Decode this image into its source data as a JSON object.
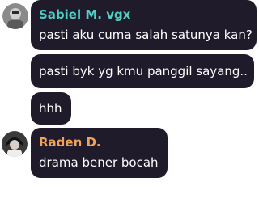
{
  "messages": [
    {
      "sender": "Sabiel M. vgx",
      "sender_color": "#4fd1c5",
      "avatar": "avatar-sabiel",
      "lines": [
        "pasti aku cuma salah satunya kan?",
        "pasti byk yg kmu panggil sayang..",
        "hhh"
      ]
    },
    {
      "sender": "Raden D.",
      "sender_color": "#f0a25b",
      "avatar": "avatar-raden",
      "lines": [
        "drama bener bocah"
      ]
    }
  ],
  "colors": {
    "bubble": "#1f1b2b",
    "text": "#ffffff",
    "background": "#ffffff"
  }
}
